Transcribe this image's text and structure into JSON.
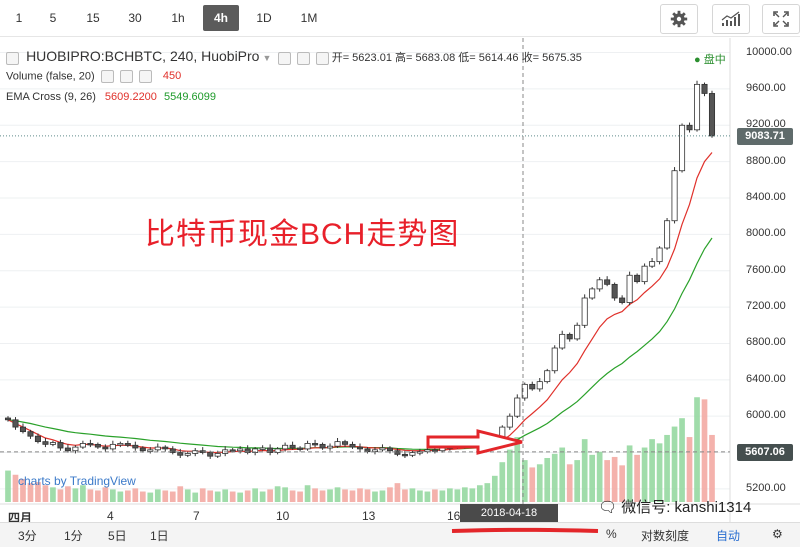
{
  "toolbar": {
    "timeframes": [
      "1",
      "5",
      "15",
      "30",
      "1h",
      "4h",
      "1D",
      "1M"
    ],
    "active_timeframe": "4h"
  },
  "legend": {
    "symbol": "HUOBIPRO:BCHBTC, 240, HuobiPro",
    "ohlc_text": "开= 5623.01 高= 5683.08 低= 5614.46 收= 5675.35",
    "market_state": "● 盘中",
    "volume_label": "Volume (false, 20)",
    "volume_value": "450",
    "ema_label": "EMA Cross (9, 26)",
    "ema_fast": "5609.2200",
    "ema_slow": "5549.6099"
  },
  "annotation": "比特币现金BCH走势图",
  "watermark": "charts by TradingView",
  "overlay_text": "微信号: kanshi1314",
  "crosshair_date": "2018-04-18 08:00:00",
  "bottom": {
    "ranges": [
      "3分",
      "1分",
      "5日",
      "1日"
    ],
    "percent": "%",
    "log_label": "对数刻度",
    "auto_label": "自动"
  },
  "colors": {
    "up": "#27a243",
    "down": "#d8402f",
    "ema_fast": "#e0312b",
    "ema_slow": "#2aa12a",
    "last_price_tag": "#5f6b6b",
    "crosshair_tag": "#454f4f"
  },
  "chart_data": {
    "type": "candlestick",
    "x_tick_labels": [
      "四月",
      "4",
      "7",
      "10",
      "13",
      "16"
    ],
    "y_tick_labels": [
      "10000.00",
      "9600.00",
      "9200.00",
      "8800.00",
      "8400.00",
      "8000.00",
      "7600.00",
      "7200.00",
      "6800.00",
      "6400.00",
      "6000.00",
      "5600.00",
      "5200.00"
    ],
    "ylim": [
      5100,
      10050
    ],
    "last_price": "9083.71",
    "crosshair_price": "5607.06",
    "close": [
      5960,
      5880,
      5830,
      5780,
      5720,
      5690,
      5710,
      5650,
      5620,
      5660,
      5700,
      5690,
      5660,
      5640,
      5690,
      5700,
      5680,
      5650,
      5620,
      5630,
      5660,
      5640,
      5600,
      5570,
      5590,
      5620,
      5600,
      5560,
      5590,
      5630,
      5620,
      5640,
      5600,
      5640,
      5650,
      5600,
      5640,
      5680,
      5650,
      5640,
      5700,
      5690,
      5650,
      5670,
      5720,
      5690,
      5660,
      5640,
      5610,
      5630,
      5650,
      5620,
      5580,
      5570,
      5600,
      5610,
      5630,
      5620,
      5650,
      5660,
      5670,
      5690,
      5700,
      5710,
      5725,
      5740,
      5880,
      6000,
      6200,
      6350,
      6300,
      6380,
      6500,
      6750,
      6900,
      6850,
      7000,
      7300,
      7400,
      7500,
      7450,
      7300,
      7250,
      7550,
      7480,
      7650,
      7700,
      7850,
      8150,
      8700,
      9200,
      9150,
      9650,
      9550,
      9083
    ],
    "ema_fast": [
      5960,
      5920,
      5880,
      5840,
      5800,
      5760,
      5740,
      5710,
      5690,
      5680,
      5690,
      5690,
      5680,
      5670,
      5675,
      5680,
      5680,
      5670,
      5660,
      5650,
      5650,
      5650,
      5640,
      5620,
      5615,
      5615,
      5610,
      5600,
      5600,
      5605,
      5610,
      5615,
      5612,
      5618,
      5622,
      5618,
      5622,
      5630,
      5635,
      5637,
      5645,
      5652,
      5652,
      5655,
      5665,
      5670,
      5668,
      5663,
      5655,
      5650,
      5650,
      5645,
      5635,
      5625,
      5620,
      5620,
      5622,
      5622,
      5628,
      5635,
      5640,
      5650,
      5660,
      5670,
      5680,
      5690,
      5730,
      5790,
      5870,
      5960,
      6030,
      6100,
      6180,
      6290,
      6400,
      6480,
      6580,
      6720,
      6850,
      6980,
      7070,
      7120,
      7150,
      7230,
      7280,
      7360,
      7430,
      7510,
      7640,
      7840,
      8110,
      8330,
      8620,
      8800,
      8900
    ],
    "ema_slow": [
      5960,
      5950,
      5935,
      5920,
      5900,
      5880,
      5865,
      5848,
      5830,
      5818,
      5810,
      5802,
      5792,
      5782,
      5775,
      5770,
      5762,
      5755,
      5745,
      5735,
      5728,
      5722,
      5713,
      5703,
      5695,
      5688,
      5682,
      5674,
      5667,
      5663,
      5659,
      5657,
      5652,
      5651,
      5650,
      5646,
      5645,
      5646,
      5646,
      5645,
      5650,
      5653,
      5653,
      5654,
      5659,
      5662,
      5662,
      5660,
      5656,
      5654,
      5654,
      5651,
      5645,
      5640,
      5637,
      5636,
      5635,
      5634,
      5635,
      5637,
      5640,
      5644,
      5648,
      5652,
      5657,
      5662,
      5680,
      5705,
      5742,
      5790,
      5830,
      5872,
      5920,
      5980,
      6045,
      6100,
      6160,
      6240,
      6320,
      6400,
      6470,
      6530,
      6580,
      6650,
      6710,
      6780,
      6850,
      6930,
      7040,
      7180,
      7350,
      7500,
      7680,
      7840,
      7960
    ],
    "volume": [
      300,
      260,
      220,
      180,
      190,
      160,
      140,
      120,
      150,
      130,
      160,
      120,
      110,
      140,
      120,
      100,
      110,
      130,
      100,
      90,
      120,
      110,
      100,
      150,
      120,
      90,
      130,
      110,
      100,
      120,
      100,
      90,
      110,
      130,
      100,
      120,
      150,
      140,
      110,
      100,
      160,
      130,
      110,
      120,
      140,
      120,
      110,
      130,
      120,
      100,
      110,
      140,
      180,
      120,
      130,
      110,
      100,
      120,
      110,
      130,
      120,
      140,
      130,
      160,
      180,
      250,
      380,
      500,
      620,
      400,
      330,
      360,
      420,
      460,
      520,
      360,
      400,
      600,
      450,
      480,
      400,
      430,
      350,
      540,
      450,
      520,
      600,
      560,
      640,
      720,
      800,
      620,
      1000,
      980,
      640
    ]
  }
}
